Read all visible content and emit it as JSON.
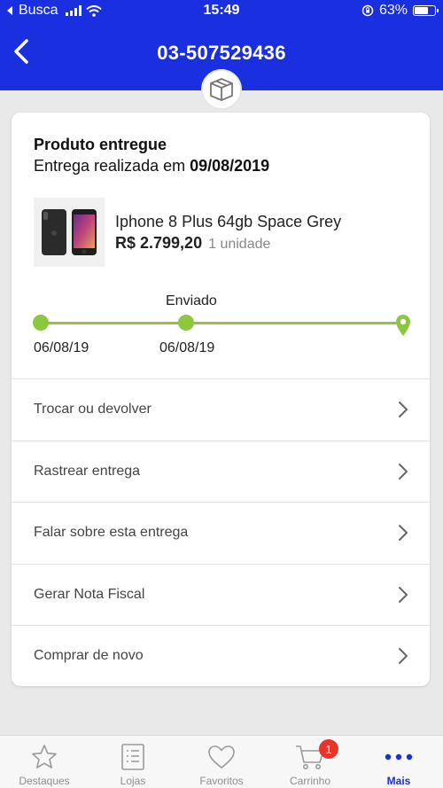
{
  "status_bar": {
    "carrier": "Busca",
    "time": "15:49",
    "battery": "63%",
    "battery_level": 0.63
  },
  "header": {
    "title": "03-507529436"
  },
  "order": {
    "status": "Produto entregue",
    "delivery_prefix": "Entrega realizada em ",
    "delivery_date": "09/08/2019",
    "product": {
      "name": "Iphone 8 Plus 64gb Space Grey",
      "price": "R$ 2.799,20",
      "quantity": "1 unidade"
    },
    "tracker": {
      "stage_label": "Enviado",
      "start_date": "06/08/19",
      "sent_date": "06/08/19",
      "color": "#8dc63f"
    }
  },
  "actions": [
    {
      "label": "Trocar ou devolver"
    },
    {
      "label": "Rastrear entrega"
    },
    {
      "label": "Falar sobre esta entrega"
    },
    {
      "label": "Gerar Nota Fiscal"
    },
    {
      "label": "Comprar de novo"
    }
  ],
  "tabs": [
    {
      "label": "Destaques",
      "icon": "star-icon"
    },
    {
      "label": "Lojas",
      "icon": "list-icon"
    },
    {
      "label": "Favoritos",
      "icon": "heart-icon"
    },
    {
      "label": "Carrinho",
      "icon": "cart-icon",
      "badge": "1"
    },
    {
      "label": "Mais",
      "icon": "more-icon",
      "active": true
    }
  ],
  "colors": {
    "brand": "#1a2fe0",
    "tracker": "#8dc63f",
    "badge": "#e8352c"
  }
}
